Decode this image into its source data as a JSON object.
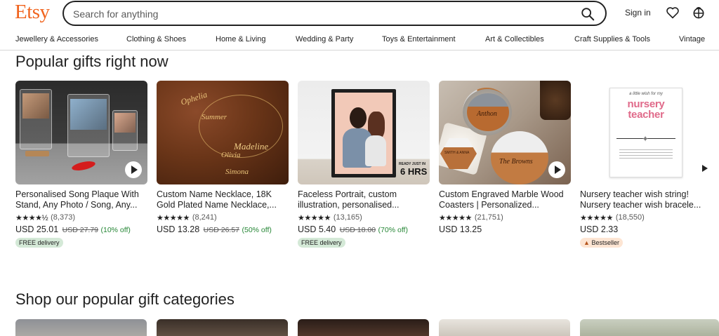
{
  "header": {
    "logo": "Etsy",
    "search_placeholder": "Search for anything",
    "signin_label": "Sign in",
    "icons": [
      "search-icon",
      "heart-icon",
      "cart-icon"
    ]
  },
  "nav": {
    "items": [
      "Jewellery & Accessories",
      "Clothing & Shoes",
      "Home & Living",
      "Wedding & Party",
      "Toys & Entertainment",
      "Art & Collectibles",
      "Craft Supplies & Tools",
      "Vintage"
    ]
  },
  "popular": {
    "heading": "Popular gifts right now",
    "cards": [
      {
        "title": "Personalised Song Plaque With Stand, Any Photo / Song, Any...",
        "stars": "★★★★½",
        "count": "(8,373)",
        "price": "USD 25.01",
        "old_price": "USD 27.79",
        "discount": "(10% off)",
        "badge": "FREE delivery",
        "video": true
      },
      {
        "title": "Custom Name Necklace, 18K Gold Plated Name Necklace,...",
        "stars": "★★★★★",
        "count": "(8,241)",
        "price": "USD 13.28",
        "old_price": "USD 26.57",
        "discount": "(50% off)",
        "badge": "",
        "video": false
      },
      {
        "title": "Faceless Portrait, custom illustration, personalised...",
        "stars": "★★★★★",
        "count": "(13,165)",
        "price": "USD 5.40",
        "old_price": "USD 18.00",
        "discount": "(70% off)",
        "badge": "FREE delivery",
        "thumb_text_small": "READY JUST IN",
        "thumb_text_big": "6 HRS",
        "video": false
      },
      {
        "title": "Custom Engraved Marble Wood Coasters | Personalized...",
        "stars": "★★★★★",
        "count": "(21,751)",
        "price": "USD 13.25",
        "old_price": "",
        "discount": "",
        "badge": "",
        "coaster_names": [
          "Anthon",
          "The Browns",
          "SMITH & ANNA"
        ],
        "video": true
      },
      {
        "title": "Nursery teacher wish string! Nursery teacher wish bracele...",
        "stars": "★★★★★",
        "count": "(18,550)",
        "price": "USD 2.33",
        "old_price": "",
        "discount": "",
        "badge": "Bestseller",
        "card_top": "a little wish for my",
        "card_big": "nursery teacher",
        "video": true
      }
    ]
  },
  "categories": {
    "heading": "Shop our popular gift categories"
  },
  "colors": {
    "brand": "#F1641E",
    "discount_green": "#258635",
    "free_delivery_bg": "#d4e9d7",
    "bestseller_bg": "#fde5d3"
  }
}
